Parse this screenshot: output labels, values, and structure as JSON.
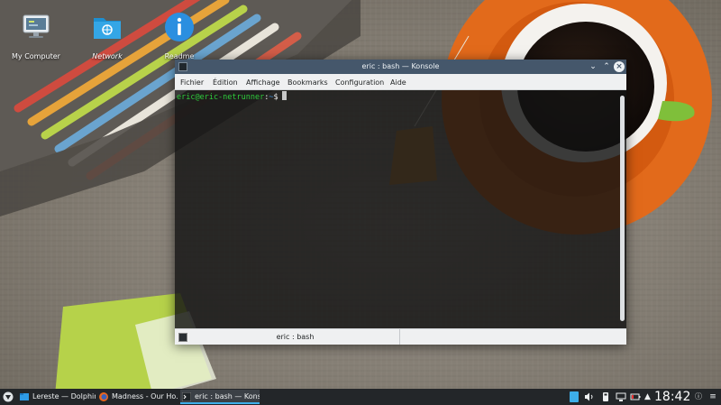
{
  "desktop": {
    "icons": [
      {
        "label": "My Computer",
        "icon": "computer-icon"
      },
      {
        "label": "Network",
        "icon": "network-folder-icon"
      },
      {
        "label": "Readme",
        "icon": "info-icon"
      }
    ]
  },
  "konsole": {
    "title": "eric : bash — Konsole",
    "menu": [
      "Fichier",
      "Édition",
      "Affichage",
      "Bookmarks",
      "Configuration",
      "Aide"
    ],
    "prompt": {
      "user_host": "eric@eric-netrunner",
      "separator": ":",
      "path": "~",
      "symbol": "$"
    },
    "tab_label": "eric : bash"
  },
  "taskbar": {
    "tasks": [
      {
        "label": "Lereste — Dolphin",
        "icon": "dolphin-icon"
      },
      {
        "label": "Madness - Our Ho...",
        "icon": "firefox-icon"
      },
      {
        "label": "eric : bash — Kons...",
        "icon": "konsole-icon"
      }
    ],
    "clock": "18:42"
  },
  "colors": {
    "titlebar": "#45576b",
    "accent": "#3daee9",
    "prompt_user": "#2ecc3c",
    "prompt_path": "#3d8dd8",
    "taskbar": "#232629"
  }
}
